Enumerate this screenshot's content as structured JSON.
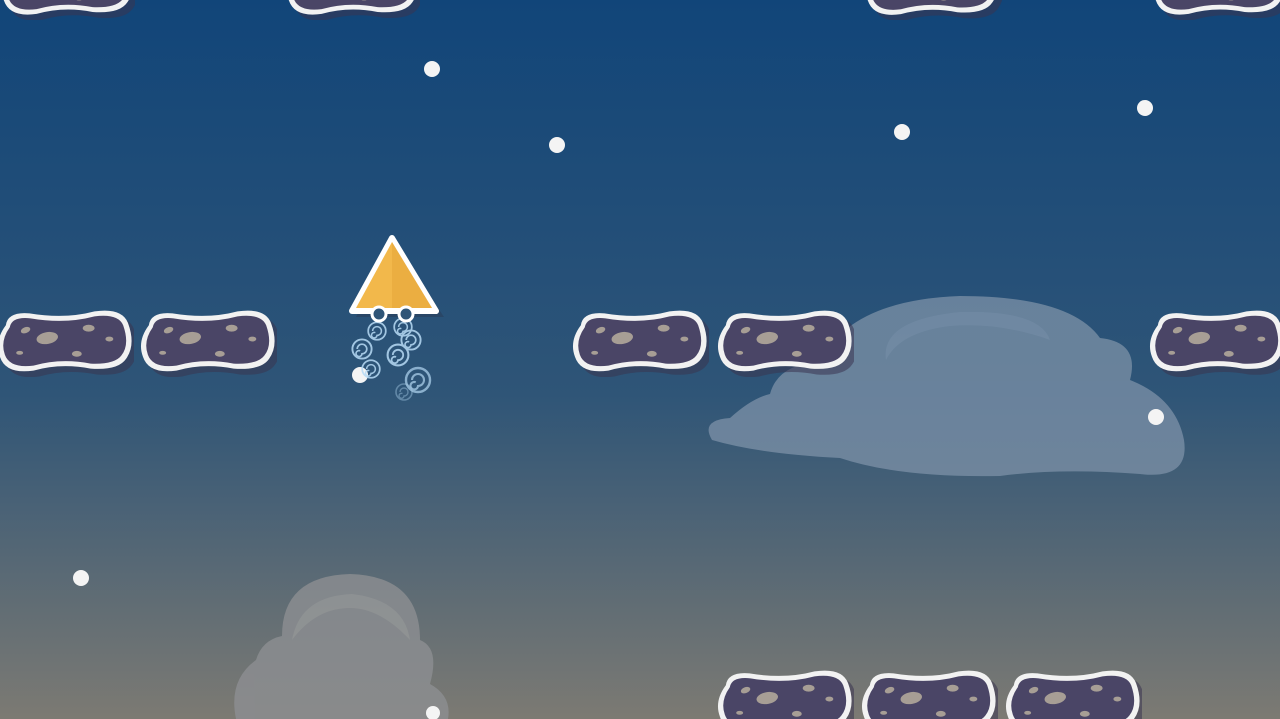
{
  "scene": {
    "sky_top_color": "#114579",
    "sky_mid_color": "#2f5577",
    "sky_bottom_color": "#7c7a73",
    "cloud_color": "#7d92a8",
    "star_color": "#f4f4f4",
    "platform_fill": "#4a4566",
    "platform_outline": "#f2f2f2",
    "pebble_color": "#a79e95",
    "player_color": "#f2b84b",
    "jet_trail_color": "#b7dbf5"
  },
  "player": {
    "icon": "triangle-rocket-icon",
    "state": "jumping"
  }
}
